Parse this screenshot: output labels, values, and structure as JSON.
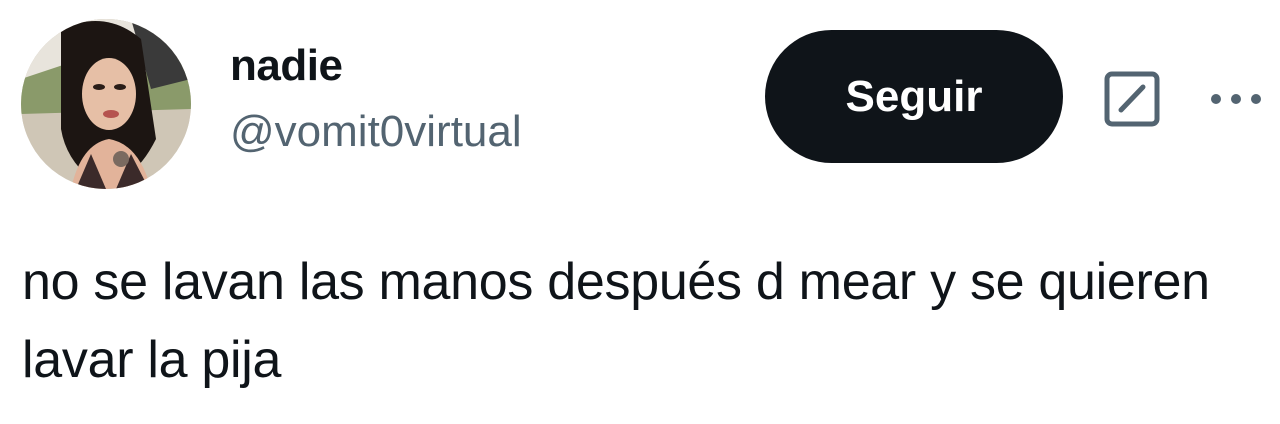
{
  "author": {
    "display_name": "nadie",
    "handle": "@vomit0virtual",
    "avatar_icon": "profile-photo"
  },
  "actions": {
    "follow_label": "Seguir",
    "grok_icon": "slash-square-icon",
    "more_icon": "more-horizontal-icon"
  },
  "tweet": {
    "text": "no se lavan las manos después d mear y se quieren lavar la pija"
  },
  "colors": {
    "text_primary": "#0f1419",
    "text_secondary": "#536471",
    "button_bg": "#0f1419",
    "button_text": "#ffffff"
  }
}
